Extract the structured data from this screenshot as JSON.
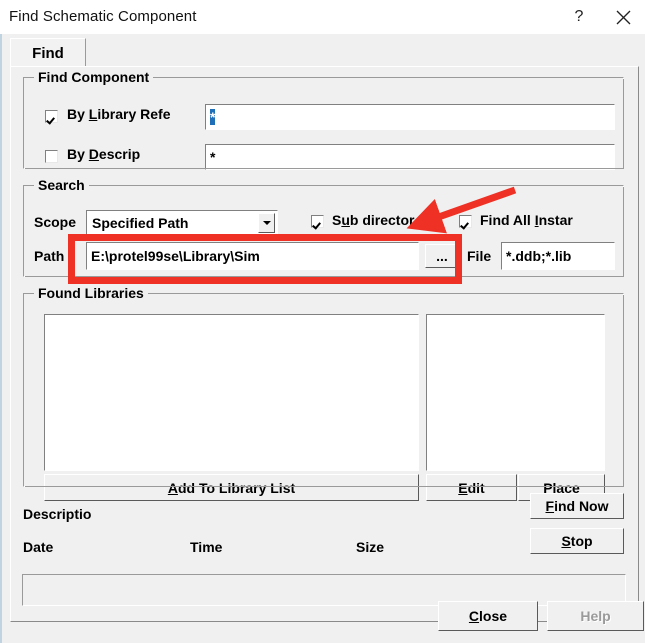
{
  "window": {
    "title": "Find Schematic Component",
    "help_glyph": "?",
    "close_glyph": "✕"
  },
  "tabs": [
    {
      "label": "Find",
      "active": true
    }
  ],
  "find_component": {
    "group_title": "Find Component",
    "by_library_ref": {
      "label_prefix": "By ",
      "label_accel": "L",
      "label_rest": "ibrary Refe",
      "checked": true,
      "value": "*",
      "value_selected": true
    },
    "by_description": {
      "label_prefix": "By ",
      "label_accel": "D",
      "label_rest": "escrip",
      "checked": false,
      "value": "*"
    }
  },
  "search": {
    "group_title": "Search",
    "scope_label": "Scope",
    "scope_value": "Specified Path",
    "scope_options": [
      "Specified Path"
    ],
    "sub_directories": {
      "label_prefix": "S",
      "label_accel": "u",
      "label_rest": "b director",
      "checked": true
    },
    "find_all_instances": {
      "label_prefix": "Find All ",
      "label_accel": "I",
      "label_rest": "nstar",
      "checked": true
    },
    "path_label": "Path",
    "path_value": "E:\\protel99se\\Library\\Sim",
    "browse_label": "...",
    "file_label": "File",
    "file_value": "*.ddb;*.lib"
  },
  "found_libraries": {
    "group_title": "Found Libraries",
    "left_list_items": [],
    "right_list_items": [],
    "add_to_library_list": {
      "accel": "A",
      "rest": "dd To Library List"
    },
    "edit": {
      "accel": "E",
      "rest": "dit"
    },
    "place": {
      "accel": "P",
      "rest": "lace"
    }
  },
  "results": {
    "description_label": "Descriptio",
    "date_label": "Date",
    "time_label": "Time",
    "size_label": "Size",
    "find_now": {
      "accel": "F",
      "rest": "ind Now"
    },
    "stop": {
      "accel": "S",
      "rest": "top"
    },
    "status_text": ""
  },
  "footer": {
    "close": {
      "accel": "C",
      "rest": "lose"
    },
    "help": {
      "accel": "H",
      "rest": "elp",
      "disabled": true
    }
  },
  "annotations": {
    "color": "#ee3124",
    "highlight_rect_target": "path-field-row",
    "arrow_target": "sub-directories-checkbox"
  }
}
